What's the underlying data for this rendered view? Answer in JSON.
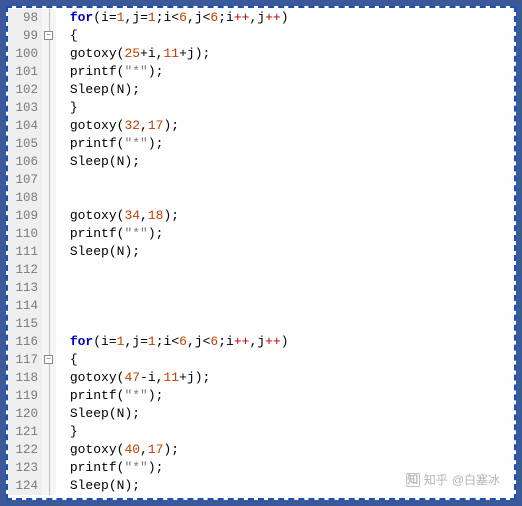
{
  "credit": {
    "platform": "知乎",
    "handle": "@白塞冰"
  },
  "fold_marker": "−",
  "lines": [
    {
      "n": 98,
      "fold": "line",
      "indent": 1,
      "tokens": [
        [
          "kw",
          "for"
        ],
        [
          "paren",
          "("
        ],
        [
          "var",
          "i"
        ],
        [
          "op",
          "="
        ],
        [
          "num",
          "1"
        ],
        [
          "op",
          ","
        ],
        [
          "var",
          "j"
        ],
        [
          "op",
          "="
        ],
        [
          "num",
          "1"
        ],
        [
          "semi",
          ";"
        ],
        [
          "var",
          "i"
        ],
        [
          "op",
          "<"
        ],
        [
          "num",
          "6"
        ],
        [
          "op",
          ","
        ],
        [
          "var",
          "j"
        ],
        [
          "op",
          "<"
        ],
        [
          "num",
          "6"
        ],
        [
          "semi",
          ";"
        ],
        [
          "var",
          "i"
        ],
        [
          "redop",
          "++"
        ],
        [
          "op",
          ","
        ],
        [
          "var",
          "j"
        ],
        [
          "redop",
          "++"
        ],
        [
          "paren",
          ")"
        ]
      ]
    },
    {
      "n": 99,
      "fold": "box",
      "indent": 1,
      "tokens": [
        [
          "brace",
          "{"
        ]
      ]
    },
    {
      "n": 100,
      "fold": "line",
      "indent": 1,
      "tokens": [
        [
          "fn",
          "gotoxy"
        ],
        [
          "paren",
          "("
        ],
        [
          "num",
          "25"
        ],
        [
          "op",
          "+"
        ],
        [
          "var",
          "i"
        ],
        [
          "op",
          ","
        ],
        [
          "num",
          "11"
        ],
        [
          "op",
          "+"
        ],
        [
          "var",
          "j"
        ],
        [
          "paren",
          ")"
        ],
        [
          "semi",
          ";"
        ]
      ]
    },
    {
      "n": 101,
      "fold": "line",
      "indent": 1,
      "tokens": [
        [
          "fn",
          "printf"
        ],
        [
          "paren",
          "("
        ],
        [
          "str",
          "\"*\""
        ],
        [
          "paren",
          ")"
        ],
        [
          "semi",
          ";"
        ]
      ]
    },
    {
      "n": 102,
      "fold": "line",
      "indent": 1,
      "tokens": [
        [
          "fn",
          "Sleep"
        ],
        [
          "paren",
          "("
        ],
        [
          "var",
          "N"
        ],
        [
          "paren",
          ")"
        ],
        [
          "semi",
          ";"
        ]
      ]
    },
    {
      "n": 103,
      "fold": "line",
      "indent": 1,
      "tokens": [
        [
          "brace",
          "}"
        ]
      ]
    },
    {
      "n": 104,
      "fold": "line",
      "indent": 1,
      "tokens": [
        [
          "fn",
          "gotoxy"
        ],
        [
          "paren",
          "("
        ],
        [
          "num",
          "32"
        ],
        [
          "op",
          ","
        ],
        [
          "num",
          "17"
        ],
        [
          "paren",
          ")"
        ],
        [
          "semi",
          ";"
        ]
      ]
    },
    {
      "n": 105,
      "fold": "line",
      "indent": 1,
      "tokens": [
        [
          "fn",
          "printf"
        ],
        [
          "paren",
          "("
        ],
        [
          "str",
          "\"*\""
        ],
        [
          "paren",
          ")"
        ],
        [
          "semi",
          ";"
        ]
      ]
    },
    {
      "n": 106,
      "fold": "line",
      "indent": 1,
      "tokens": [
        [
          "fn",
          "Sleep"
        ],
        [
          "paren",
          "("
        ],
        [
          "var",
          "N"
        ],
        [
          "paren",
          ")"
        ],
        [
          "semi",
          ";"
        ]
      ]
    },
    {
      "n": 107,
      "fold": "line",
      "indent": 0,
      "tokens": []
    },
    {
      "n": 108,
      "fold": "line",
      "indent": 0,
      "tokens": []
    },
    {
      "n": 109,
      "fold": "line",
      "indent": 1,
      "tokens": [
        [
          "fn",
          "gotoxy"
        ],
        [
          "paren",
          "("
        ],
        [
          "num",
          "34"
        ],
        [
          "op",
          ","
        ],
        [
          "num",
          "18"
        ],
        [
          "paren",
          ")"
        ],
        [
          "semi",
          ";"
        ]
      ]
    },
    {
      "n": 110,
      "fold": "line",
      "indent": 1,
      "tokens": [
        [
          "fn",
          "printf"
        ],
        [
          "paren",
          "("
        ],
        [
          "str",
          "\"*\""
        ],
        [
          "paren",
          ")"
        ],
        [
          "semi",
          ";"
        ]
      ]
    },
    {
      "n": 111,
      "fold": "line",
      "indent": 1,
      "tokens": [
        [
          "fn",
          "Sleep"
        ],
        [
          "paren",
          "("
        ],
        [
          "var",
          "N"
        ],
        [
          "paren",
          ")"
        ],
        [
          "semi",
          ";"
        ]
      ]
    },
    {
      "n": 112,
      "fold": "line",
      "indent": 0,
      "tokens": []
    },
    {
      "n": 113,
      "fold": "line",
      "indent": 0,
      "tokens": []
    },
    {
      "n": 114,
      "fold": "line",
      "indent": 0,
      "tokens": []
    },
    {
      "n": 115,
      "fold": "line",
      "indent": 0,
      "tokens": []
    },
    {
      "n": 116,
      "fold": "line",
      "indent": 1,
      "tokens": [
        [
          "kw",
          "for"
        ],
        [
          "paren",
          "("
        ],
        [
          "var",
          "i"
        ],
        [
          "op",
          "="
        ],
        [
          "num",
          "1"
        ],
        [
          "op",
          ","
        ],
        [
          "var",
          "j"
        ],
        [
          "op",
          "="
        ],
        [
          "num",
          "1"
        ],
        [
          "semi",
          ";"
        ],
        [
          "var",
          "i"
        ],
        [
          "op",
          "<"
        ],
        [
          "num",
          "6"
        ],
        [
          "op",
          ","
        ],
        [
          "var",
          "j"
        ],
        [
          "op",
          "<"
        ],
        [
          "num",
          "6"
        ],
        [
          "semi",
          ";"
        ],
        [
          "var",
          "i"
        ],
        [
          "redop",
          "++"
        ],
        [
          "op",
          ","
        ],
        [
          "var",
          "j"
        ],
        [
          "redop",
          "++"
        ],
        [
          "paren",
          ")"
        ]
      ]
    },
    {
      "n": 117,
      "fold": "box",
      "indent": 1,
      "tokens": [
        [
          "brace",
          "{"
        ]
      ]
    },
    {
      "n": 118,
      "fold": "line",
      "indent": 1,
      "tokens": [
        [
          "fn",
          "gotoxy"
        ],
        [
          "paren",
          "("
        ],
        [
          "num",
          "47"
        ],
        [
          "op",
          "-"
        ],
        [
          "var",
          "i"
        ],
        [
          "op",
          ","
        ],
        [
          "num",
          "11"
        ],
        [
          "op",
          "+"
        ],
        [
          "var",
          "j"
        ],
        [
          "paren",
          ")"
        ],
        [
          "semi",
          ";"
        ]
      ]
    },
    {
      "n": 119,
      "fold": "line",
      "indent": 1,
      "tokens": [
        [
          "fn",
          "printf"
        ],
        [
          "paren",
          "("
        ],
        [
          "str",
          "\"*\""
        ],
        [
          "paren",
          ")"
        ],
        [
          "semi",
          ";"
        ]
      ]
    },
    {
      "n": 120,
      "fold": "line",
      "indent": 1,
      "tokens": [
        [
          "fn",
          "Sleep"
        ],
        [
          "paren",
          "("
        ],
        [
          "var",
          "N"
        ],
        [
          "paren",
          ")"
        ],
        [
          "semi",
          ";"
        ]
      ]
    },
    {
      "n": 121,
      "fold": "line",
      "indent": 1,
      "tokens": [
        [
          "brace",
          "}"
        ]
      ]
    },
    {
      "n": 122,
      "fold": "line",
      "indent": 1,
      "tokens": [
        [
          "fn",
          "gotoxy"
        ],
        [
          "paren",
          "("
        ],
        [
          "num",
          "40"
        ],
        [
          "op",
          ","
        ],
        [
          "num",
          "17"
        ],
        [
          "paren",
          ")"
        ],
        [
          "semi",
          ";"
        ]
      ]
    },
    {
      "n": 123,
      "fold": "line",
      "indent": 1,
      "tokens": [
        [
          "fn",
          "printf"
        ],
        [
          "paren",
          "("
        ],
        [
          "str",
          "\"*\""
        ],
        [
          "paren",
          ")"
        ],
        [
          "semi",
          ";"
        ]
      ]
    },
    {
      "n": 124,
      "fold": "line",
      "indent": 1,
      "tokens": [
        [
          "fn",
          "Sleep"
        ],
        [
          "paren",
          "("
        ],
        [
          "var",
          "N"
        ],
        [
          "paren",
          ")"
        ],
        [
          "semi",
          ";"
        ]
      ]
    }
  ]
}
